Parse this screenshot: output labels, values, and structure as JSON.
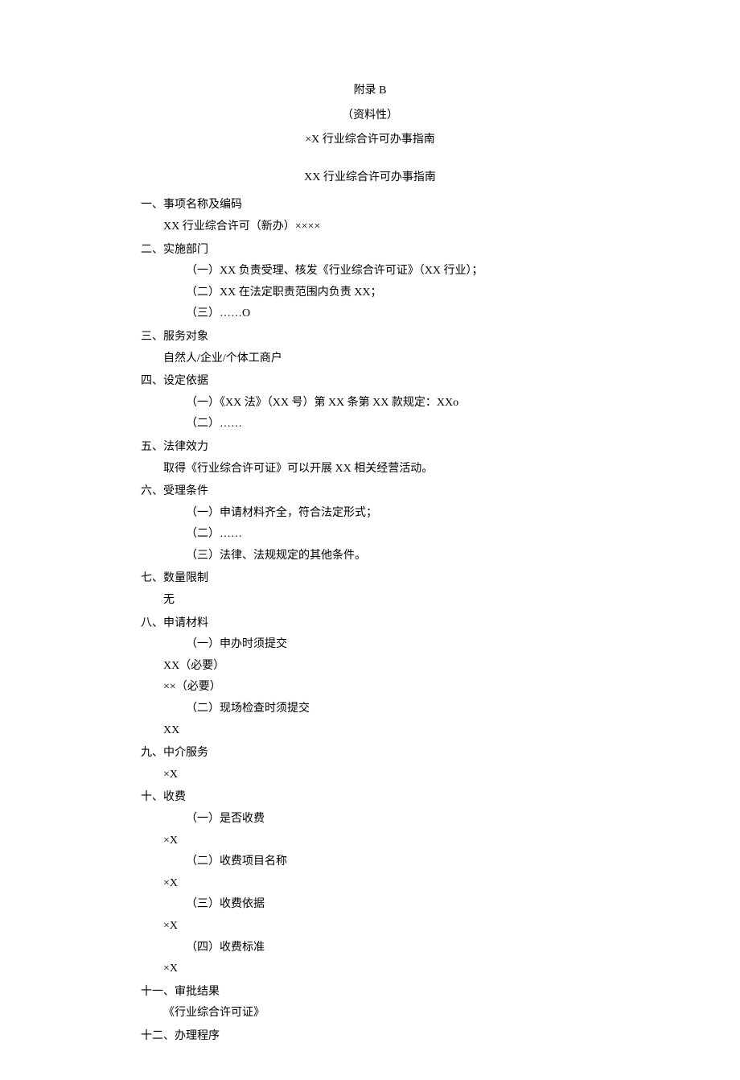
{
  "header": {
    "appendix": "附录 B",
    "subtitle": "（资料性）",
    "doc_title": "×X 行业综合许可办事指南"
  },
  "main_title": "XX 行业综合许可办事指南",
  "sections": {
    "s1": {
      "heading": "一、事项名称及编码",
      "line1": "XX 行业综合许可（新办）××××"
    },
    "s2": {
      "heading": "二、实施部门",
      "item1": "（一）XX 负责受理、核发《行业综合许可证》（XX 行业）；",
      "item2": "（二）XX 在法定职责范围内负责 XX；",
      "item3": "（三）……O"
    },
    "s3": {
      "heading": "三、服务对象",
      "line1": "自然人/企业/个体工商户"
    },
    "s4": {
      "heading": "四、设定依据",
      "item1": "（一）《XX 法》（XX 号）第 XX 条第 XX 款规定：XXo",
      "item2": "（二）……"
    },
    "s5": {
      "heading": "五、法律效力",
      "line1": "取得《行业综合许可证》可以开展 XX 相关经营活动。"
    },
    "s6": {
      "heading": "六、受理条件",
      "item1": "（一）申请材料齐全，符合法定形式；",
      "item2": "（二）……",
      "item3": "（三）法律、法规规定的其他条件。"
    },
    "s7": {
      "heading": "七、数量限制",
      "line1": "无"
    },
    "s8": {
      "heading": "八、申请材料",
      "item1": "（一）申办时须提交",
      "line1": "XX（必要）",
      "line2": "××（必要）",
      "item2": "（二）现场检查时须提交",
      "line3": "XX"
    },
    "s9": {
      "heading": "九、中介服务",
      "line1": "×X"
    },
    "s10": {
      "heading": "十、收费",
      "item1": "（一）是否收费",
      "line1": "×X",
      "item2": "（二）收费项目名称",
      "line2": "×X",
      "item3": "（三）收费依据",
      "line3": "×X",
      "item4": "（四）收费标准",
      "line4": "×X"
    },
    "s11": {
      "heading": "十一、审批结果",
      "line1": "《行业综合许可证》"
    },
    "s12": {
      "heading": "十二、办理程序"
    }
  }
}
